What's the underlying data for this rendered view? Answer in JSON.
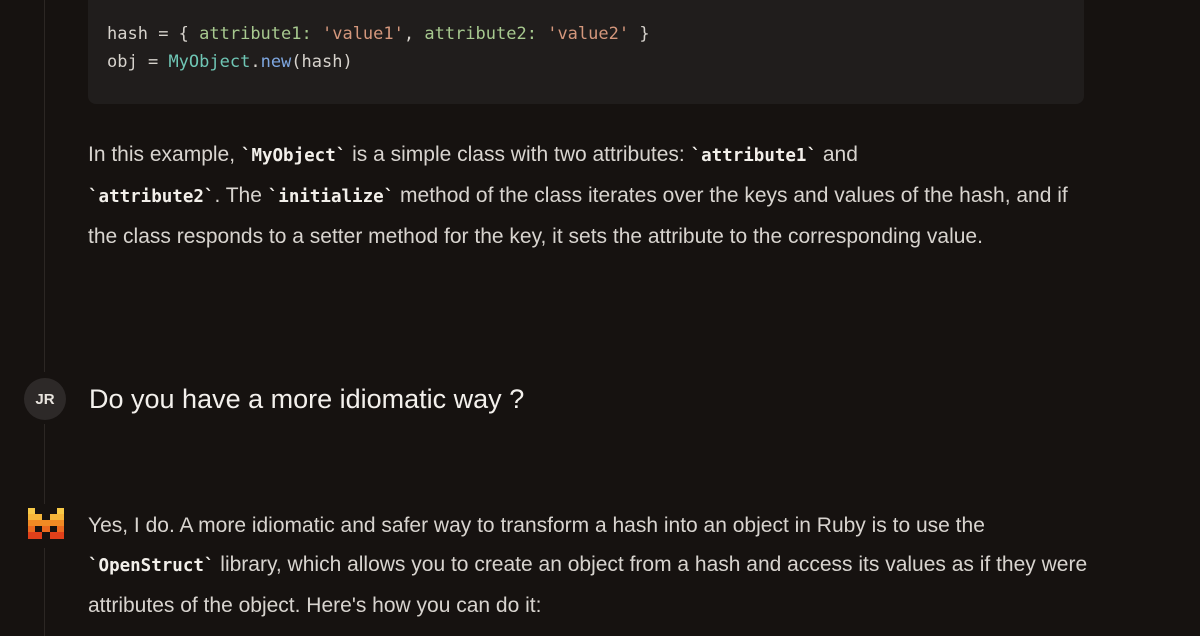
{
  "code": {
    "line1": {
      "var": "hash",
      "eq": " = { ",
      "key1": "attribute1:",
      "sp1": " ",
      "val1": "'value1'",
      "comma": ", ",
      "key2": "attribute2:",
      "sp2": " ",
      "val2": "'value2'",
      "close": " }"
    },
    "line2": {
      "var": "obj",
      "eq": " = ",
      "class": "MyObject",
      "dot": ".",
      "method": "new",
      "args": "(hash)"
    }
  },
  "answer1": {
    "t1": "In this example, ",
    "c1": "`MyObject`",
    "t2": " is a simple class with two attributes: ",
    "c2": "`attribute1`",
    "t3": " and ",
    "c3": "`attribute2`",
    "t4": ". The ",
    "c4": "`initialize`",
    "t5": " method of the class iterates over the keys and values of the hash, and if the class responds to a setter method for the key, it sets the attribute to the corresponding value."
  },
  "user": {
    "initials": "JR",
    "message": "Do you have a more idiomatic way ?"
  },
  "answer2": {
    "t1": "Yes, I do. A more idiomatic and safer way to transform a hash into an object in Ruby is to use the ",
    "c1": "`OpenStruct`",
    "t2": " library, which allows you to create an object from a hash and access its values as if they were attributes of the object. Here's how you can do it:"
  },
  "colors": {
    "background": "#161210",
    "code_bg": "#201d1c",
    "string": "#d4977c",
    "symbol": "#a7c98f",
    "class": "#6fc6b5",
    "method": "#7ea7e0",
    "logo_yellow": "#f7c948",
    "logo_orange": "#f08a24",
    "logo_red": "#e0401a"
  },
  "icons": {
    "assistant_logo": "mistral-logo-icon"
  }
}
